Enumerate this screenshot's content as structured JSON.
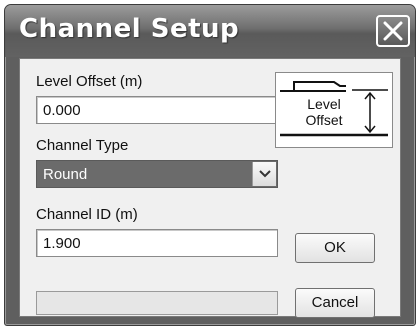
{
  "window": {
    "title": "Channel Setup",
    "close_icon": "close-icon"
  },
  "fields": {
    "level_offset_label": "Level Offset (m)",
    "level_offset_value": "0.000",
    "channel_type_label": "Channel Type",
    "channel_type_value": "Round",
    "channel_id_label": "Channel ID (m)",
    "channel_id_value": "1.900"
  },
  "diagram": {
    "line1": "Level",
    "line2": "Offset"
  },
  "buttons": {
    "ok_label": "OK",
    "cancel_label": "Cancel"
  },
  "status": {
    "value": ""
  },
  "colors": {
    "title_bar": "#6e6e6e",
    "dialog_background": "#f0f0f0",
    "combo_selected_background": "#6b6b6b"
  }
}
